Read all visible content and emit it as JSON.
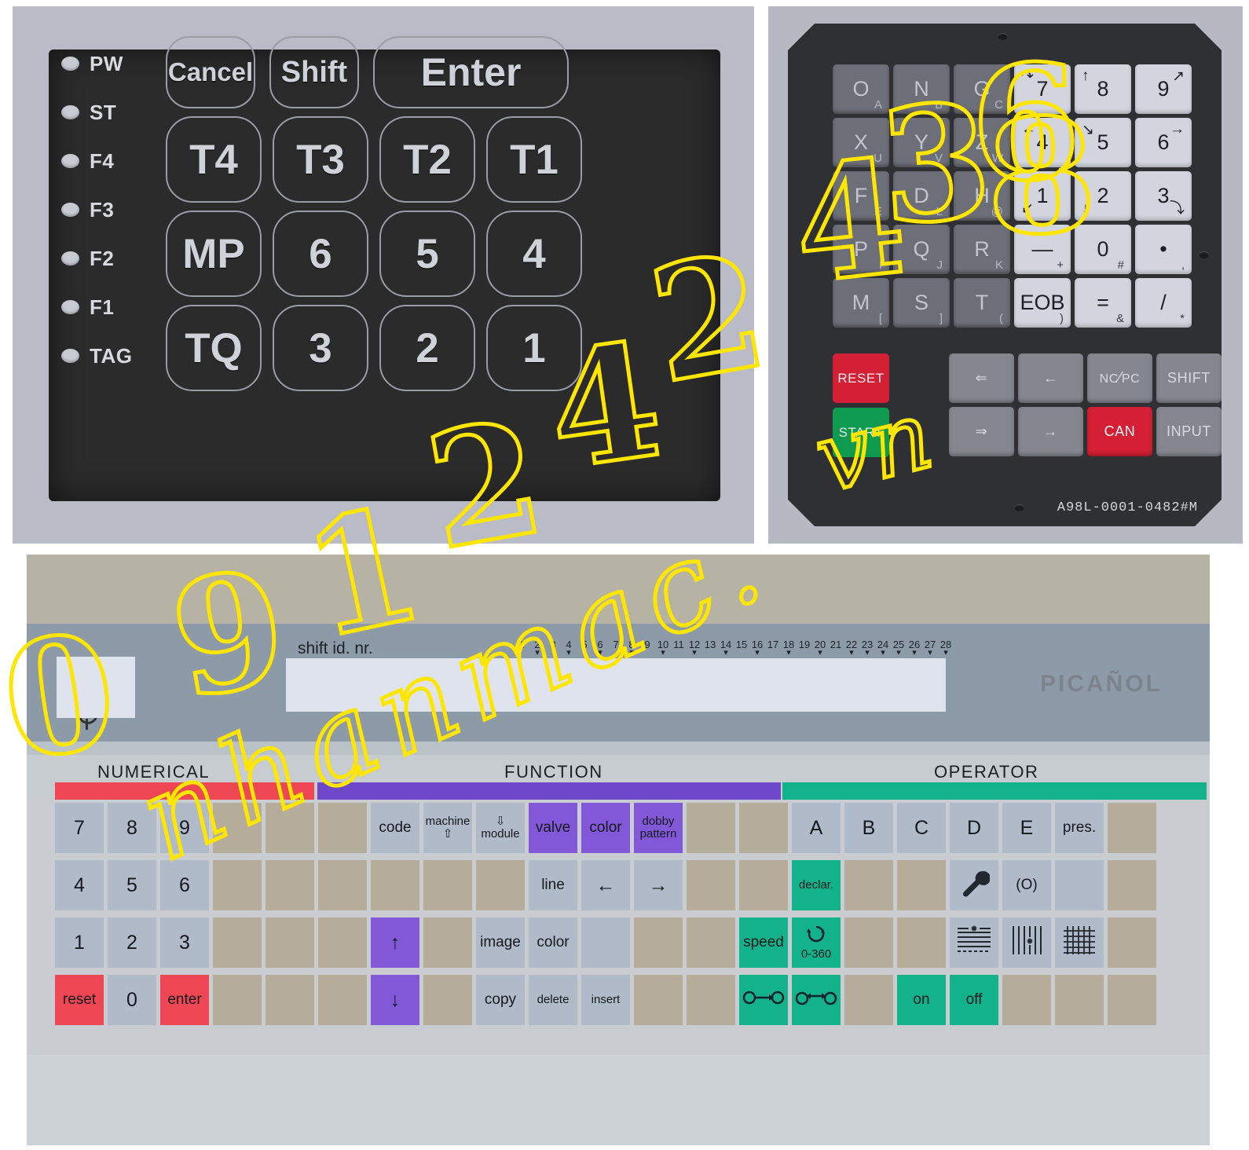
{
  "panel_a": {
    "name": "membrane-keypad-overlay",
    "leds": [
      "PW",
      "ST",
      "F4",
      "F3",
      "F2",
      "F1",
      "TAG"
    ],
    "rows": [
      [
        {
          "label": "Cancel",
          "size": "s"
        },
        {
          "label": "Shift",
          "size": "s"
        },
        {
          "label": "Enter",
          "size": "w"
        }
      ],
      [
        {
          "label": "T4"
        },
        {
          "label": "T3"
        },
        {
          "label": "T2"
        },
        {
          "label": "T1"
        }
      ],
      [
        {
          "label": "MP"
        },
        {
          "label": "6"
        },
        {
          "label": "5"
        },
        {
          "label": "4"
        }
      ],
      [
        {
          "label": "TQ"
        },
        {
          "label": "3"
        },
        {
          "label": "2"
        },
        {
          "label": "1"
        }
      ]
    ]
  },
  "panel_b": {
    "name": "fanuc-keypad-membrane",
    "model": "A98L-0001-0482#M",
    "grid": [
      {
        "main": "O",
        "sub": "A",
        "kind": "alpha"
      },
      {
        "main": "N",
        "sub": "B",
        "kind": "alpha"
      },
      {
        "main": "G",
        "sub": "C",
        "kind": "alpha"
      },
      {
        "main": "7",
        "icon_tl": "↷",
        "kind": "num"
      },
      {
        "main": "8",
        "icon_tl": "↑",
        "kind": "num"
      },
      {
        "main": "9",
        "icon_tr": "↗",
        "kind": "num"
      },
      {
        "main": "X",
        "sub": "U",
        "kind": "alpha"
      },
      {
        "main": "Y",
        "sub": "V",
        "kind": "alpha"
      },
      {
        "main": "Z",
        "sub": "W",
        "kind": "alpha"
      },
      {
        "main": "4",
        "icon_tl": "←",
        "kind": "num"
      },
      {
        "main": "5",
        "icon_tl": "↘",
        "kind": "num"
      },
      {
        "main": "6",
        "icon_tr": "→",
        "kind": "num"
      },
      {
        "main": "F",
        "sub": "E",
        "kind": "alpha"
      },
      {
        "main": "D",
        "sub": "L",
        "kind": "alpha"
      },
      {
        "main": "H",
        "sub": "@",
        "kind": "alpha"
      },
      {
        "main": "1",
        "icon_bl": "↙",
        "kind": "num"
      },
      {
        "main": "2",
        "icon_bl": "↓",
        "kind": "num"
      },
      {
        "main": "3",
        "icon_br": "⤵",
        "kind": "num"
      },
      {
        "main": "P",
        "sub": "I",
        "kind": "alpha"
      },
      {
        "main": "Q",
        "sub": "J",
        "kind": "alpha"
      },
      {
        "main": "R",
        "sub": "K",
        "kind": "alpha"
      },
      {
        "main": "—",
        "sub": "+",
        "kind": "num"
      },
      {
        "main": "0",
        "sub": "#",
        "kind": "num"
      },
      {
        "main": "•",
        "sub": ",",
        "kind": "num"
      },
      {
        "main": "M",
        "sub": "[",
        "kind": "alpha"
      },
      {
        "main": "S",
        "sub": "]",
        "kind": "alpha"
      },
      {
        "main": "T",
        "sub": "(",
        "kind": "alpha"
      },
      {
        "main": "EOB",
        "sub": ")",
        "kind": "num"
      },
      {
        "main": "=",
        "sub": "&",
        "kind": "num"
      },
      {
        "main": "/",
        "sub": "*",
        "kind": "num"
      }
    ],
    "left_keys": [
      {
        "label": "RESET",
        "color": "red"
      },
      {
        "label": "START",
        "color": "green"
      }
    ],
    "right_keys": [
      {
        "label": "⇐",
        "kind": "icon"
      },
      {
        "label": "←",
        "kind": "icon"
      },
      {
        "label": "NC/PC",
        "kind": "text"
      },
      {
        "label": "SHIFT",
        "kind": "text"
      },
      {
        "label": "⇒",
        "kind": "icon"
      },
      {
        "label": "→",
        "kind": "icon"
      },
      {
        "label": "CAN",
        "kind": "can"
      },
      {
        "label": "INPUT",
        "kind": "text"
      }
    ]
  },
  "panel_c": {
    "name": "picanol-loom-keyboard-overlay",
    "brand": "PICAÑOL",
    "shift_label": "shift  id. nr.",
    "scale_ticks": [
      "1",
      "2",
      "3",
      "4",
      "5",
      "6",
      "7",
      "8",
      "9",
      "10",
      "11",
      "12",
      "13",
      "14",
      "15",
      "16",
      "17",
      "18",
      "19",
      "20",
      "21",
      "22",
      "23",
      "24",
      "25",
      "26",
      "27",
      "28"
    ],
    "sections": [
      {
        "label": "NUMERICAL",
        "color": "#ef4654"
      },
      {
        "label": "FUNCTION",
        "color": "#6f47c9"
      },
      {
        "label": "OPERATOR",
        "color": "#12b38b"
      }
    ],
    "keyrows": [
      [
        {
          "label": "7",
          "style": "grey"
        },
        {
          "label": "8",
          "style": "grey"
        },
        {
          "label": "9",
          "style": "grey"
        },
        {
          "label": "",
          "style": "blank"
        },
        {
          "label": "",
          "style": "blank"
        },
        {
          "label": "",
          "style": "blank"
        },
        {
          "label": "code",
          "style": "grey",
          "size": "sm"
        },
        {
          "label": "machine\n⇧",
          "style": "grey",
          "size": "xs"
        },
        {
          "label": "⇩\nmodule",
          "style": "grey",
          "size": "xs"
        },
        {
          "label": "valve",
          "style": "purple",
          "size": "sm"
        },
        {
          "label": "color",
          "style": "purple",
          "size": "sm"
        },
        {
          "label": "dobby\npattern",
          "style": "purple",
          "size": "xs"
        },
        {
          "label": "",
          "style": "blank"
        },
        {
          "label": "",
          "style": "blank"
        },
        {
          "label": "A",
          "style": "grey"
        },
        {
          "label": "B",
          "style": "grey"
        },
        {
          "label": "C",
          "style": "grey"
        },
        {
          "label": "D",
          "style": "grey"
        },
        {
          "label": "E",
          "style": "grey"
        },
        {
          "label": "pres.",
          "style": "grey",
          "size": "sm"
        },
        {
          "label": "",
          "style": "blank"
        }
      ],
      [
        {
          "label": "4",
          "style": "grey"
        },
        {
          "label": "5",
          "style": "grey"
        },
        {
          "label": "6",
          "style": "grey"
        },
        {
          "label": "",
          "style": "blank"
        },
        {
          "label": "",
          "style": "blank"
        },
        {
          "label": "",
          "style": "blank"
        },
        {
          "label": "",
          "style": "blank"
        },
        {
          "label": "",
          "style": "blank"
        },
        {
          "label": "",
          "style": "blank"
        },
        {
          "label": "line",
          "style": "grey",
          "size": "sm"
        },
        {
          "label": "←",
          "style": "grey"
        },
        {
          "label": "→",
          "style": "grey"
        },
        {
          "label": "",
          "style": "blank"
        },
        {
          "label": "",
          "style": "blank"
        },
        {
          "label": "declar.",
          "style": "teal",
          "size": "xs"
        },
        {
          "label": "",
          "style": "blank"
        },
        {
          "label": "",
          "style": "blank"
        },
        {
          "label": "wrench",
          "style": "grey",
          "icon": "wrench"
        },
        {
          "label": "(O)",
          "style": "grey",
          "size": "sm"
        },
        {
          "label": "",
          "style": "grey"
        },
        {
          "label": "",
          "style": "blank"
        }
      ],
      [
        {
          "label": "1",
          "style": "grey"
        },
        {
          "label": "2",
          "style": "grey"
        },
        {
          "label": "3",
          "style": "grey"
        },
        {
          "label": "",
          "style": "blank"
        },
        {
          "label": "",
          "style": "blank"
        },
        {
          "label": "",
          "style": "blank"
        },
        {
          "label": "↑",
          "style": "purple"
        },
        {
          "label": "",
          "style": "blank"
        },
        {
          "label": "image",
          "style": "grey",
          "size": "sm"
        },
        {
          "label": "color",
          "style": "grey",
          "size": "sm"
        },
        {
          "label": "",
          "style": "grey"
        },
        {
          "label": "",
          "style": "blank"
        },
        {
          "label": "",
          "style": "blank"
        },
        {
          "label": "speed",
          "style": "teal",
          "size": "sm"
        },
        {
          "label": "0-360",
          "style": "teal",
          "icon": "rot",
          "size": "xs"
        },
        {
          "label": "",
          "style": "blank"
        },
        {
          "label": "",
          "style": "blank"
        },
        {
          "label": "weft",
          "style": "grey",
          "icon": "weft"
        },
        {
          "label": "warp",
          "style": "grey",
          "icon": "warp"
        },
        {
          "label": "fabric",
          "style": "grey",
          "icon": "fabric"
        },
        {
          "label": "",
          "style": "blank"
        }
      ],
      [
        {
          "label": "reset",
          "style": "red",
          "size": "sm"
        },
        {
          "label": "0",
          "style": "grey"
        },
        {
          "label": "enter",
          "style": "red",
          "size": "sm"
        },
        {
          "label": "",
          "style": "blank"
        },
        {
          "label": "",
          "style": "blank"
        },
        {
          "label": "",
          "style": "blank"
        },
        {
          "label": "↓",
          "style": "purple"
        },
        {
          "label": "",
          "style": "blank"
        },
        {
          "label": "copy",
          "style": "grey",
          "size": "sm"
        },
        {
          "label": "delete",
          "style": "grey",
          "size": "xs"
        },
        {
          "label": "insert",
          "style": "grey",
          "size": "xs"
        },
        {
          "label": "",
          "style": "blank"
        },
        {
          "label": "",
          "style": "blank"
        },
        {
          "label": "link1",
          "style": "teal",
          "icon": "link1"
        },
        {
          "label": "link2",
          "style": "teal",
          "icon": "link2"
        },
        {
          "label": "",
          "style": "blank"
        },
        {
          "label": "on",
          "style": "teal",
          "size": "sm"
        },
        {
          "label": "off",
          "style": "teal",
          "size": "sm"
        },
        {
          "label": "",
          "style": "blank"
        },
        {
          "label": "",
          "style": "blank"
        },
        {
          "label": "",
          "style": "blank"
        }
      ]
    ]
  },
  "watermark": {
    "phone": "0912424368",
    "site": "nhanmac.",
    "tld": "vn",
    "color": "#ffe600"
  }
}
